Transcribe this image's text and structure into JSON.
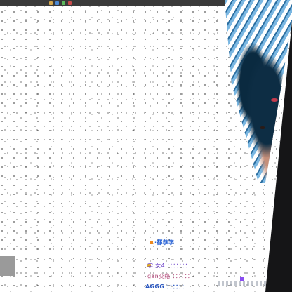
{
  "stream": {
    "preview_label": ""
  },
  "chat": {
    "messages": [
      {
        "text": "·都恭学"
      },
      {
        "text": "学 女4 ：：：：：：："
      },
      {
        "text": "gan交络 ：：：：：："
      },
      {
        "text": "AGGG ：：：：：："
      }
    ]
  },
  "colors": {
    "accent": "#2fbac6",
    "background": "#ffffff",
    "frame": "#151517"
  }
}
